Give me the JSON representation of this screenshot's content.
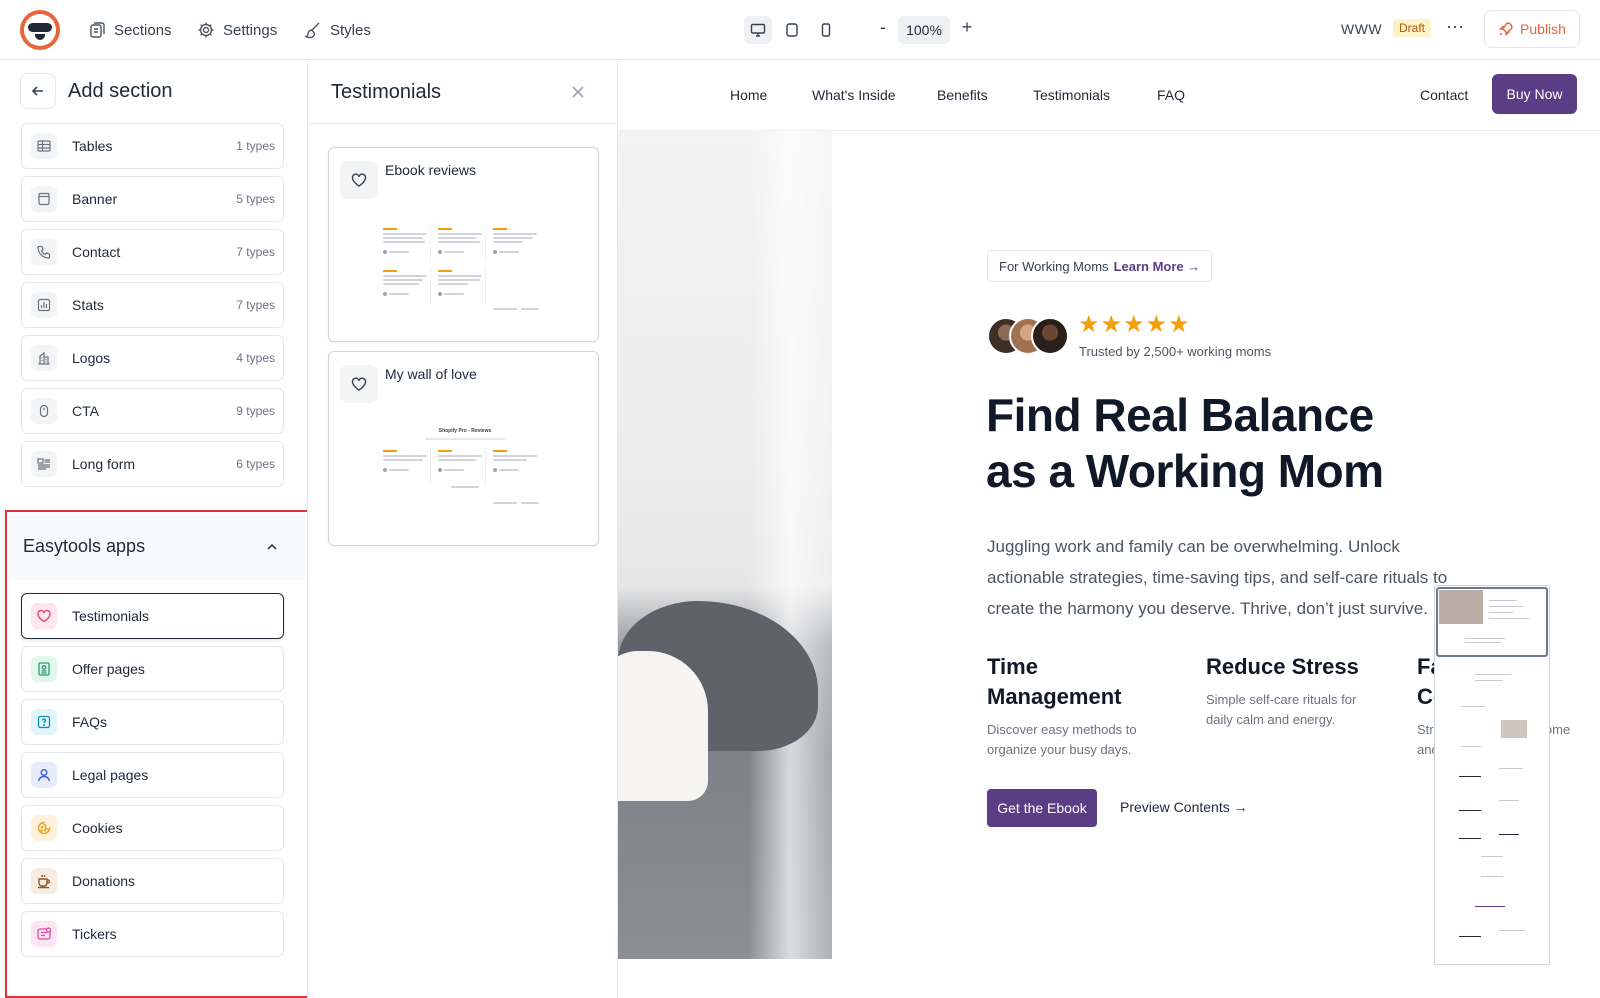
{
  "topbar": {
    "nav": [
      {
        "label": "Sections",
        "icon": "sections-icon"
      },
      {
        "label": "Settings",
        "icon": "gear-icon"
      },
      {
        "label": "Styles",
        "icon": "brush-icon"
      }
    ],
    "devices": [
      "desktop-icon",
      "tablet-icon",
      "mobile-icon"
    ],
    "zoom_minus": "-",
    "zoom": "100%",
    "zoom_plus": "+",
    "domain": "WWW",
    "status": "Draft",
    "more": "···",
    "publish_label": "Publish",
    "accent": "#e8663c"
  },
  "sidebar": {
    "title": "Add section",
    "sections": [
      {
        "label": "Tables",
        "count": "1 types",
        "icon": "table-icon"
      },
      {
        "label": "Banner",
        "count": "5 types",
        "icon": "banner-icon"
      },
      {
        "label": "Contact",
        "count": "7 types",
        "icon": "phone-icon"
      },
      {
        "label": "Stats",
        "count": "7 types",
        "icon": "stats-icon"
      },
      {
        "label": "Logos",
        "count": "4 types",
        "icon": "building-icon"
      },
      {
        "label": "CTA",
        "count": "9 types",
        "icon": "pointer-icon"
      },
      {
        "label": "Long form",
        "count": "6 types",
        "icon": "longform-icon"
      }
    ],
    "apps_title": "Easytools apps",
    "apps": [
      {
        "label": "Testimonials",
        "icon": "heart-icon",
        "color": "#e2476b",
        "bg": "#fde7ee"
      },
      {
        "label": "Offer pages",
        "icon": "offer-icon",
        "color": "#22a06b",
        "bg": "#e3f6ec"
      },
      {
        "label": "FAQs",
        "icon": "question-icon",
        "color": "#0891b2",
        "bg": "#e0f4f9"
      },
      {
        "label": "Legal pages",
        "icon": "user-icon",
        "color": "#3b5bdb",
        "bg": "#e7ecfb"
      },
      {
        "label": "Cookies",
        "icon": "cookie-icon",
        "color": "#e8a21b",
        "bg": "#fdf1dc"
      },
      {
        "label": "Donations",
        "icon": "cup-icon",
        "color": "#8a5a2b",
        "bg": "#f6ece1"
      },
      {
        "label": "Tickers",
        "icon": "ticker-icon",
        "color": "#e0479e",
        "bg": "#fde6f3"
      }
    ]
  },
  "panel": {
    "title": "Testimonials",
    "cards": [
      {
        "title": "Ebook reviews"
      },
      {
        "title": "My wall of love",
        "preview_heading": "Shopify Pro - Reviews"
      }
    ]
  },
  "site": {
    "nav": [
      "Home",
      "What's Inside",
      "Benefits",
      "Testimonials",
      "FAQ"
    ],
    "contact": "Contact",
    "buy": "Buy Now",
    "pill_text": "For Working Moms",
    "pill_link": "Learn More →",
    "stars": "★★★★★",
    "trusted": "Trusted by 2,500+ working moms",
    "headline_1": "Find Real Balance",
    "headline_2": "as a Working Mom",
    "subtext": "Juggling work and family can be overwhelming. Unlock actionable strategies, time-saving tips, and self-care rituals to create the harmony you deserve. Thrive, don’t just survive.",
    "features": [
      {
        "title": "Time Management",
        "desc": "Discover easy methods to organize your busy days."
      },
      {
        "title": "Reduce Stress",
        "desc": "Simple self-care rituals for daily calm and energy."
      },
      {
        "title": "Family Connection",
        "desc": "Strengthen bonds at home and..."
      }
    ],
    "cta": "Get the Ebook",
    "preview": "Preview Contents  →",
    "brand": "#5b3d86"
  }
}
